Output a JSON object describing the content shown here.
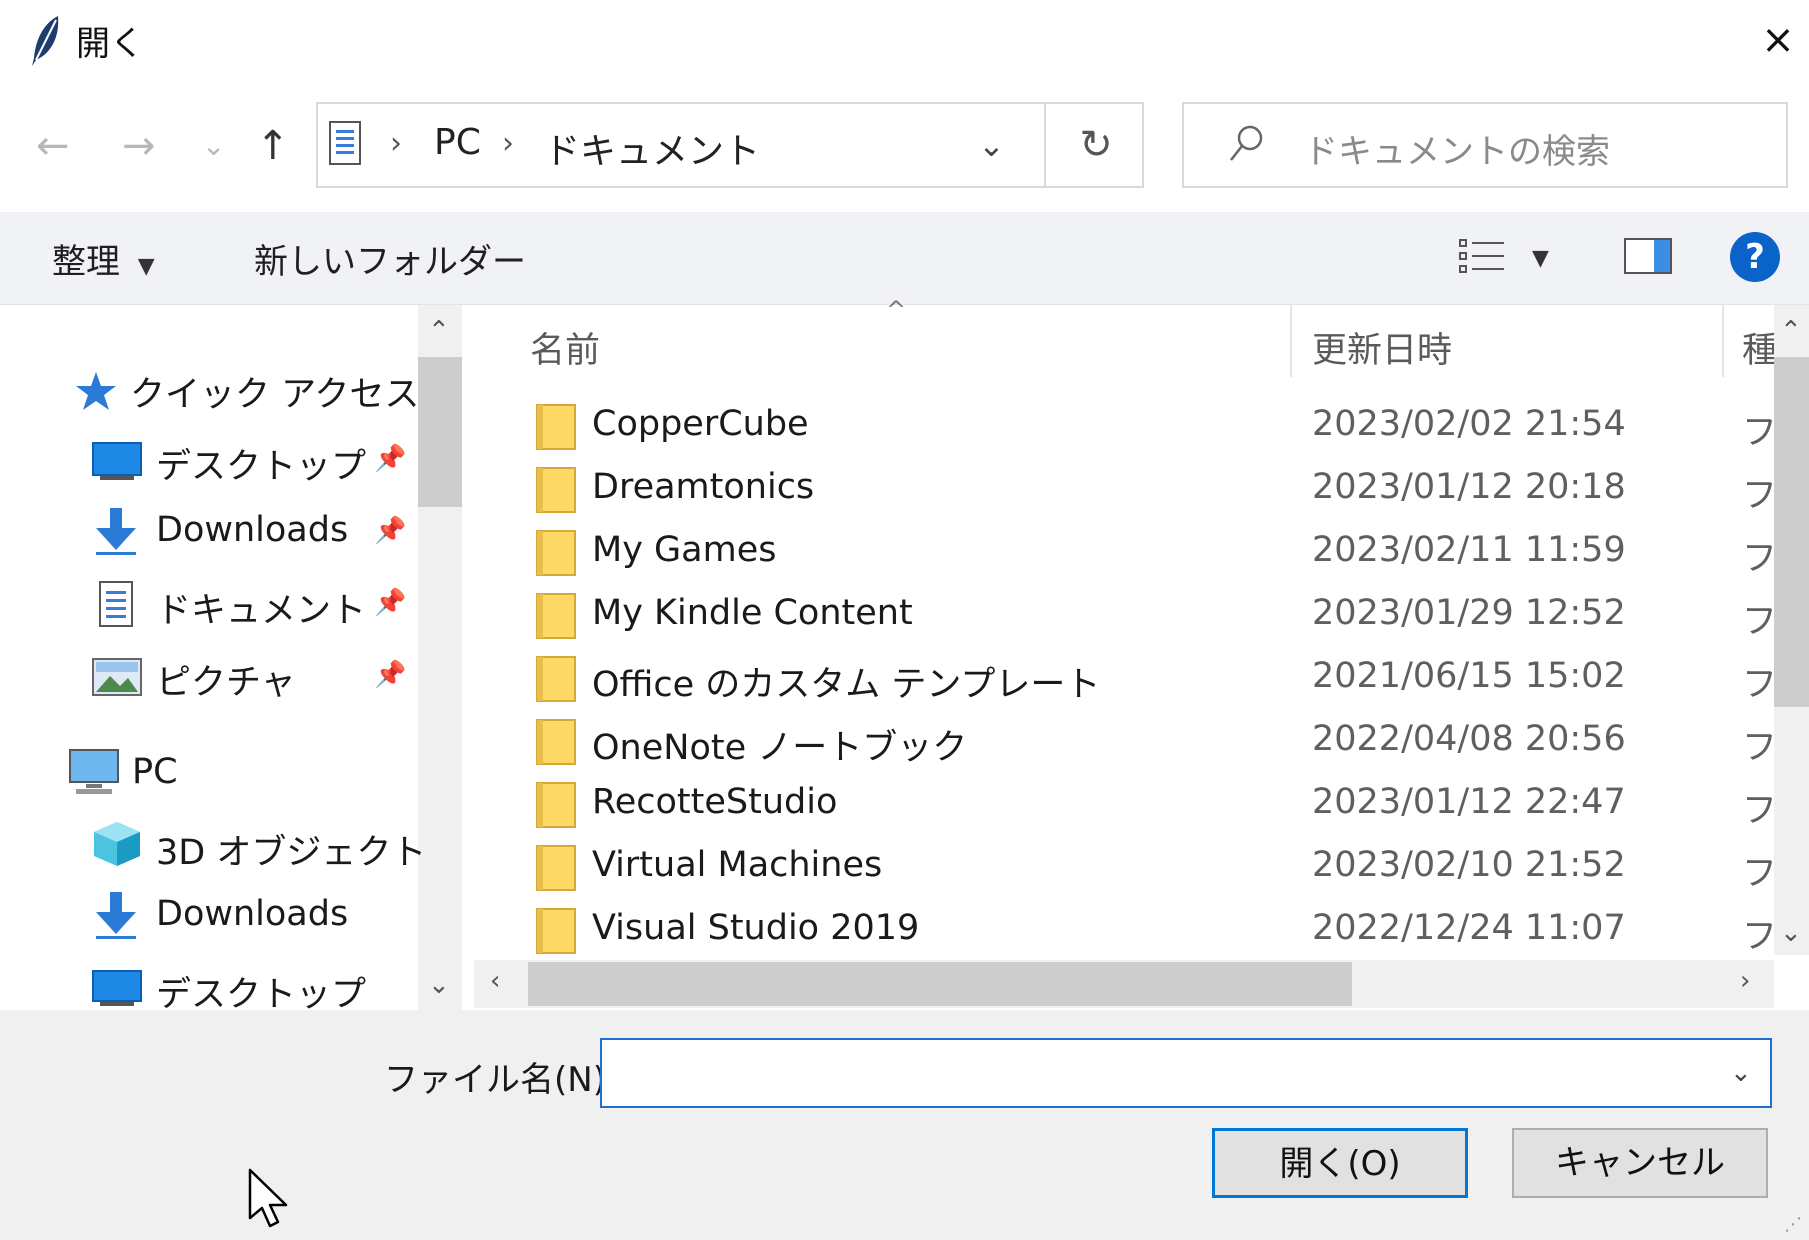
{
  "window": {
    "title": "開く",
    "close_label": "×",
    "app_icon": "feather-icon"
  },
  "nav": {
    "back": "←",
    "forward": "→",
    "recent": "⌄",
    "up": "↑",
    "breadcrumb": [
      "PC",
      "ドキュメント"
    ],
    "breadcrumb_sep": "›",
    "dropdown": "⌄",
    "refresh": "↻",
    "search_placeholder": "ドキュメントの検索"
  },
  "commandbar": {
    "organize": "整理",
    "new_folder": "新しいフォルダー",
    "help": "?"
  },
  "navpane": {
    "quick_access": "クイック アクセス",
    "quick_items": [
      {
        "label": "デスクトップ",
        "icon": "desktop-icon"
      },
      {
        "label": "Downloads",
        "icon": "download-icon"
      },
      {
        "label": "ドキュメント",
        "icon": "document-icon"
      },
      {
        "label": "ピクチャ",
        "icon": "pictures-icon"
      }
    ],
    "pc": "PC",
    "pc_items": [
      {
        "label": "3D オブジェクト",
        "icon": "3d-objects-icon"
      },
      {
        "label": "Downloads",
        "icon": "download-icon"
      },
      {
        "label": "デスクトップ",
        "icon": "desktop-icon"
      }
    ],
    "pin_glyph": "📌"
  },
  "filelist": {
    "columns": {
      "name": "名前",
      "modified": "更新日時",
      "type": "種"
    },
    "sort_caret": "^",
    "rows": [
      {
        "name": "CopperCube",
        "date": "2023/02/02 21:54",
        "type": "フ"
      },
      {
        "name": "Dreamtonics",
        "date": "2023/01/12 20:18",
        "type": "フ"
      },
      {
        "name": "My Games",
        "date": "2023/02/11 11:59",
        "type": "フ"
      },
      {
        "name": "My Kindle Content",
        "date": "2023/01/29 12:52",
        "type": "フ"
      },
      {
        "name": "Office のカスタム テンプレート",
        "date": "2021/06/15 15:02",
        "type": "フ"
      },
      {
        "name": "OneNote ノートブック",
        "date": "2022/04/08 20:56",
        "type": "フ"
      },
      {
        "name": "RecotteStudio",
        "date": "2023/01/12 22:47",
        "type": "フ"
      },
      {
        "name": "Virtual Machines",
        "date": "2023/02/10 21:52",
        "type": "フ"
      },
      {
        "name": "Visual Studio 2019",
        "date": "2022/12/24 11:07",
        "type": "フ"
      }
    ]
  },
  "bottom": {
    "filename_label": "ファイル名(N):",
    "filename_value": "",
    "open_button": "開く(O)",
    "cancel_button": "キャンセル"
  },
  "colors": {
    "accent": "#0078d7",
    "help": "#0a63c9",
    "folder": "#ffd966"
  }
}
